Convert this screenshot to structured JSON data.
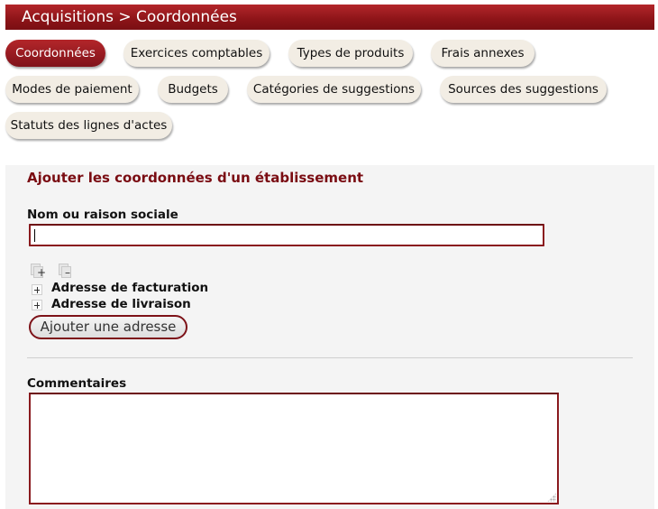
{
  "header": {
    "title": "Acquisitions > Coordonnées"
  },
  "tabs": [
    {
      "label": "Coordonnées",
      "active": true
    },
    {
      "label": "Exercices comptables"
    },
    {
      "label": "Types de produits"
    },
    {
      "label": "Frais annexes"
    },
    {
      "label": "Modes de paiement"
    },
    {
      "label": "Budgets"
    },
    {
      "label": "Catégories de suggestions"
    },
    {
      "label": "Sources des suggestions"
    },
    {
      "label": "Statuts des lignes d'actes"
    }
  ],
  "form": {
    "heading": "Ajouter les coordonnées d'un établissement",
    "name_label": "Nom ou raison sociale",
    "name_value": "",
    "addresses": [
      {
        "label": "Adresse de facturation"
      },
      {
        "label": "Adresse de livraison"
      }
    ],
    "add_address_button": "Ajouter une adresse",
    "comments_label": "Commentaires",
    "comments_value": ""
  },
  "icons": {
    "expand_all": "expand-all-icon",
    "collapse_all": "collapse-all-icon",
    "expander": "plus-expander-icon"
  },
  "colors": {
    "brand": "#8c1418",
    "tab_bg": "#f2ede4",
    "panel_bg": "#f4f4f4",
    "heading": "#7a0c12"
  }
}
